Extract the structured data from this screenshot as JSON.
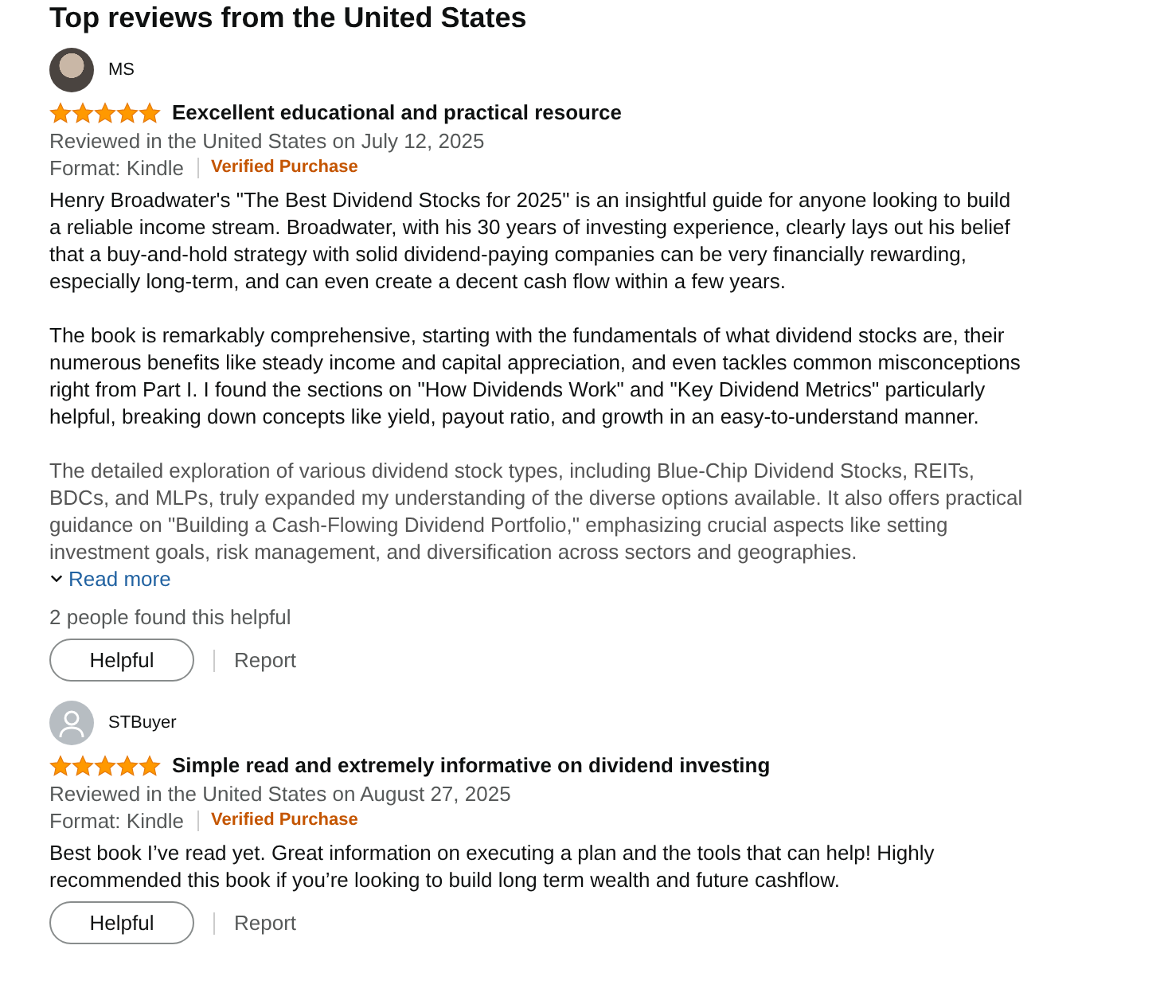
{
  "heading": "Top reviews from the United States",
  "reviews": [
    {
      "author": "MS",
      "kind": "photo",
      "stars": 5,
      "title": "Eexcellent educational and practical resource",
      "reviewed": "Reviewed in the United States on July 12, 2025",
      "format": "Format: Kindle",
      "verified": "Verified Purchase",
      "paragraphs": [
        "Henry Broadwater's \"The Best Dividend Stocks for 2025\" is an insightful guide for anyone looking to build a reliable income stream. Broadwater, with his 30 years of investing experience, clearly lays out his belief that a buy-and-hold strategy with solid dividend-paying companies can be very financially rewarding, especially long-term, and can even create a decent cash flow within a few years.",
        "The book is remarkably comprehensive, starting with the fundamentals of what dividend stocks are, their numerous benefits like steady income and capital appreciation, and even tackles common misconceptions right from Part I. I found the sections on \"How Dividends Work\" and \"Key Dividend Metrics\" particularly helpful, breaking down concepts like yield, payout ratio, and growth in an easy-to-understand manner.",
        "The detailed exploration of various dividend stock types, including Blue-Chip Dividend Stocks, REITs, BDCs, and MLPs, truly expanded my understanding of the diverse options available. It also offers practical guidance on \"Building a Cash-Flowing Dividend Portfolio,\" emphasizing crucial aspects like setting investment goals, risk management, and diversification across sectors and geographies."
      ],
      "read_more": "Read more",
      "helpful_count": "2 people found this helpful",
      "helpful": "Helpful",
      "report": "Report"
    },
    {
      "author": "STBuyer",
      "kind": "generic",
      "stars": 5,
      "title": "Simple read and extremely informative on dividend investing",
      "reviewed": "Reviewed in the United States on August 27, 2025",
      "format": "Format: Kindle",
      "verified": "Verified Purchase",
      "paragraphs": [
        "Best book I’ve read yet. Great information on executing a plan and the tools that can help! Highly recommended this book if you’re looking to build long term wealth and future cashflow."
      ],
      "helpful": "Helpful",
      "report": "Report"
    }
  ]
}
